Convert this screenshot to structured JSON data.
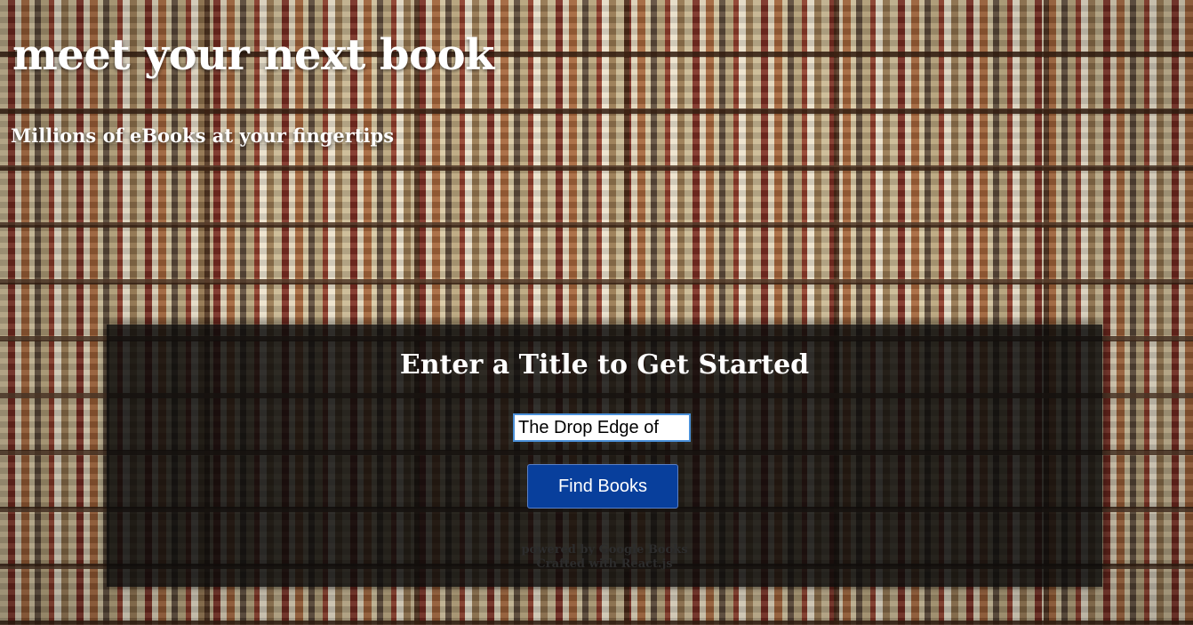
{
  "hero": {
    "title": "meet your next book",
    "subtitle": "Millions of eBooks at your fingertips"
  },
  "search_panel": {
    "heading": "Enter a Title to Get Started",
    "input_value": "The Drop Edge of",
    "button_label": "Find Books"
  },
  "footer": {
    "line1": "powered by Google Books",
    "line2": "Crafted with React.js"
  },
  "colors": {
    "button_bg": "#083f9c",
    "panel_bg": "rgba(10,10,10,0.82)",
    "input_focus_border": "#4a90d9"
  }
}
